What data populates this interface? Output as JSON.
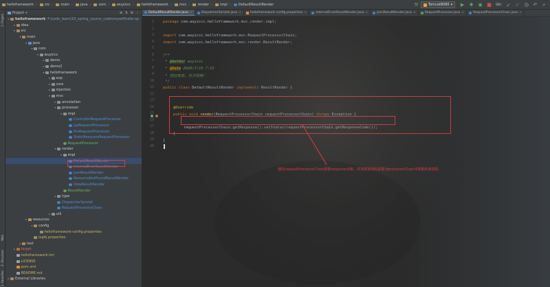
{
  "navbar": {
    "breadcrumbs": [
      "helloframework",
      "src",
      "main",
      "java",
      "com",
      "wuyiccc",
      "helloframework",
      "mvc",
      "render",
      "impl",
      "DefaultResultRender"
    ],
    "run_config": "Tomcat8080",
    "git_label": "Git:"
  },
  "side_labels": {
    "project": "1: Project",
    "structure": "Z: Structure",
    "favorites": "2: Favorites",
    "web": "Web"
  },
  "project": {
    "title": "Project",
    "root_name": "helloframework",
    "root_path": "F:\\code_learn\\10_spring_source_code\\myself\\hello-sp",
    "tree": [
      {
        "depth": 1,
        "label": "idea",
        "icon": "folder",
        "arrow": ">"
      },
      {
        "depth": 1,
        "label": "src",
        "icon": "folder",
        "arrow": "v"
      },
      {
        "depth": 2,
        "label": "main",
        "icon": "folder",
        "arrow": "v"
      },
      {
        "depth": 3,
        "label": "java",
        "icon": "src",
        "arrow": "v"
      },
      {
        "depth": 4,
        "label": "com",
        "icon": "pkg",
        "arrow": "v"
      },
      {
        "depth": 5,
        "label": "wuyiccc",
        "icon": "pkg",
        "arrow": "v"
      },
      {
        "depth": 6,
        "label": "demo",
        "icon": "pkg",
        "arrow": ">"
      },
      {
        "depth": 6,
        "label": "demo2",
        "icon": "pkg",
        "arrow": ">"
      },
      {
        "depth": 6,
        "label": "helloframework",
        "icon": "pkg",
        "arrow": "v"
      },
      {
        "depth": 7,
        "label": "aop",
        "icon": "pkg",
        "arrow": ">"
      },
      {
        "depth": 7,
        "label": "core",
        "icon": "pkg",
        "arrow": ">"
      },
      {
        "depth": 7,
        "label": "injection",
        "icon": "pkg",
        "arrow": ">"
      },
      {
        "depth": 7,
        "label": "mvc",
        "icon": "pkg",
        "arrow": "v"
      },
      {
        "depth": 8,
        "label": "annotation",
        "icon": "pkg",
        "arrow": ">"
      },
      {
        "depth": 8,
        "label": "processor",
        "icon": "pkg",
        "arrow": "v"
      },
      {
        "depth": 9,
        "label": "impl",
        "icon": "pkg",
        "arrow": "v"
      },
      {
        "depth": 10,
        "label": "ControllerRequestProcessor",
        "icon": "java",
        "arrow": ""
      },
      {
        "depth": 10,
        "label": "JspRequestProcessor",
        "icon": "java",
        "arrow": ""
      },
      {
        "depth": 10,
        "label": "PreRequestProcessor",
        "icon": "java",
        "arrow": ""
      },
      {
        "depth": 10,
        "label": "StaticResourceRequestProcessor",
        "icon": "java",
        "arrow": ""
      },
      {
        "depth": 9,
        "label": "RequestProcessor",
        "icon": "iface",
        "arrow": ""
      },
      {
        "depth": 8,
        "label": "render",
        "icon": "pkg",
        "arrow": "v"
      },
      {
        "depth": 9,
        "label": "impl",
        "icon": "pkg",
        "arrow": "v"
      },
      {
        "depth": 10,
        "label": "DefaultResultRender",
        "icon": "java",
        "arrow": "",
        "selected": true
      },
      {
        "depth": 10,
        "label": "InternalErrorResultRender",
        "icon": "java",
        "arrow": ""
      },
      {
        "depth": 10,
        "label": "JsonResultRender",
        "icon": "java",
        "arrow": ""
      },
      {
        "depth": 10,
        "label": "ResourceNotFoundResultRender",
        "icon": "java",
        "arrow": ""
      },
      {
        "depth": 10,
        "label": "ViewResultRender",
        "icon": "java",
        "arrow": ""
      },
      {
        "depth": 9,
        "label": "ResultRender",
        "icon": "iface",
        "arrow": ""
      },
      {
        "depth": 8,
        "label": "type",
        "icon": "pkg",
        "arrow": ">"
      },
      {
        "depth": 8,
        "label": "DispatcherServlet",
        "icon": "java",
        "arrow": ""
      },
      {
        "depth": 8,
        "label": "RequestProcessorChain",
        "icon": "java",
        "arrow": ""
      },
      {
        "depth": 7,
        "label": "util",
        "icon": "pkg",
        "arrow": ">"
      },
      {
        "depth": 3,
        "label": "resources",
        "icon": "res",
        "arrow": "v"
      },
      {
        "depth": 4,
        "label": "config",
        "icon": "folder",
        "arrow": "v"
      },
      {
        "depth": 5,
        "label": "helloframework-config.properties",
        "icon": "props",
        "arrow": ""
      },
      {
        "depth": 4,
        "label": "log4j.properties",
        "icon": "props",
        "arrow": ""
      },
      {
        "depth": 2,
        "label": "test",
        "icon": "folder",
        "arrow": ">"
      },
      {
        "depth": 1,
        "label": "target",
        "icon": "target",
        "arrow": ">"
      },
      {
        "depth": 1,
        "label": "helloframework.iml",
        "icon": "file",
        "arrow": ""
      },
      {
        "depth": 1,
        "label": "LICENSE",
        "icon": "file",
        "arrow": ""
      },
      {
        "depth": 1,
        "label": "pom.xml",
        "icon": "xml",
        "arrow": ""
      },
      {
        "depth": 1,
        "label": "README.md",
        "icon": "file",
        "arrow": ""
      },
      {
        "depth": 0,
        "label": "External Libraries",
        "icon": "folder",
        "arrow": ">"
      }
    ]
  },
  "tabs": [
    {
      "label": "DefaultResultRender.java",
      "icon": "java",
      "active": true
    },
    {
      "label": "DispatcherServlet.java",
      "icon": "java"
    },
    {
      "label": "helloframework-config.properties",
      "icon": "xml"
    },
    {
      "label": "InternalErrorResultRender.java",
      "icon": "java"
    },
    {
      "label": "JsonResultRender.java",
      "icon": "java"
    },
    {
      "label": "RequestProcessor.java",
      "icon": "iface"
    },
    {
      "label": "RequestProcessorChain.java",
      "icon": "java"
    }
  ],
  "code": {
    "line_numbers": [
      "1",
      "2",
      "3",
      "4",
      "5",
      "6",
      "7",
      "8",
      "9",
      "10",
      "11",
      "12",
      "13",
      "14",
      "15",
      "16",
      "17",
      "18",
      "19",
      "20"
    ],
    "l1_kw": "package",
    "l1_rest": " com.wuyiccc.helloframework.mvc.render.impl;",
    "l3_kw": "import",
    "l3_rest": " com.wuyiccc.helloframework.mvc.RequestProcessorChain;",
    "l4_kw": "import",
    "l4_rest": " com.wuyiccc.helloframework.mvc.render.ResultRender;",
    "l6": "/**",
    "l7_star": " * ",
    "l7_tag": "@Author",
    "l7_val": " wuyiccc",
    "l8_star": " * ",
    "l8_tag": "@Date",
    "l8_val": " 2020/7/15 7:52",
    "l9": " * 岂曰无衣，与子同袍~",
    "l10": " */",
    "l11_kw1": "public class",
    "l11_name": " DefaultResultRender ",
    "l11_kw2": "implements",
    "l11_rest": " ResultRender {",
    "l14_ann": "@Override",
    "l15_kw1": "public void",
    "l15_fn": " render",
    "l15_args": "(RequestProcessorChain requestProcessorChain) ",
    "l15_kw2": "throws",
    "l15_rest": " Exception {",
    "l17": "requestProcessorChain.getResponse().setStatus(requestProcessorChain.getResponseCode());",
    "l18": "}",
    "l19": "}"
  },
  "annotation": "通过requestProcessorChain获取response对象，并将其状态码设置为processorChain中获取的状态码"
}
